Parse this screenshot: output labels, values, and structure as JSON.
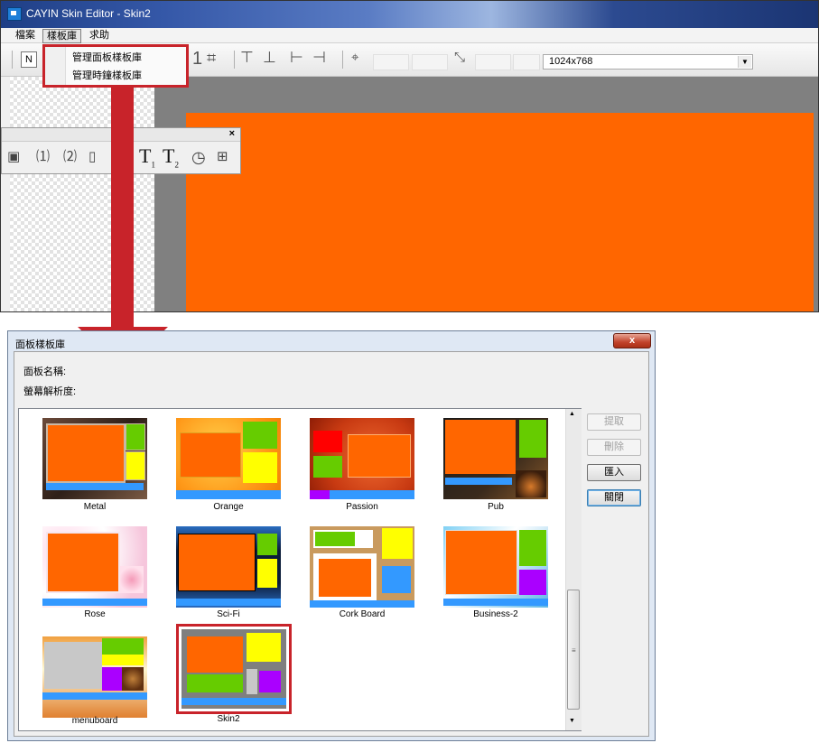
{
  "window": {
    "title": "CAYIN Skin Editor - Skin2"
  },
  "menubar": {
    "file": "檔案",
    "library": "樣板庫",
    "help": "求助"
  },
  "library_menu": {
    "items": [
      "管理面板樣板庫",
      "管理時鐘樣板庫"
    ]
  },
  "toolbar": {
    "resolution": "1024x768",
    "new_label": "N",
    "one_label": "1"
  },
  "palette": {
    "close": "×",
    "t1": "T",
    "t1_sub": "1",
    "t2": "T",
    "t2_sub": "2"
  },
  "dialog": {
    "title": "面板樣板庫",
    "close_label": "x",
    "name_label": "面板名稱:",
    "resolution_label": "螢幕解析度:",
    "buttons": {
      "extract": "提取",
      "delete": "刪除",
      "import": "匯入",
      "close": "關閉"
    },
    "templates": [
      "Metal",
      "Orange",
      "Passion",
      "Pub",
      "Rose",
      "Sci-Fi",
      "Cork Board",
      "Business-2",
      "menuboard",
      "Skin2"
    ],
    "selected": "Skin2"
  },
  "colors": {
    "highlight": "#c8232a",
    "panel_orange": "#ff6600",
    "green": "#66cc00",
    "yellow": "#ffff00",
    "blue": "#3399ff",
    "purple": "#aa00ff"
  }
}
